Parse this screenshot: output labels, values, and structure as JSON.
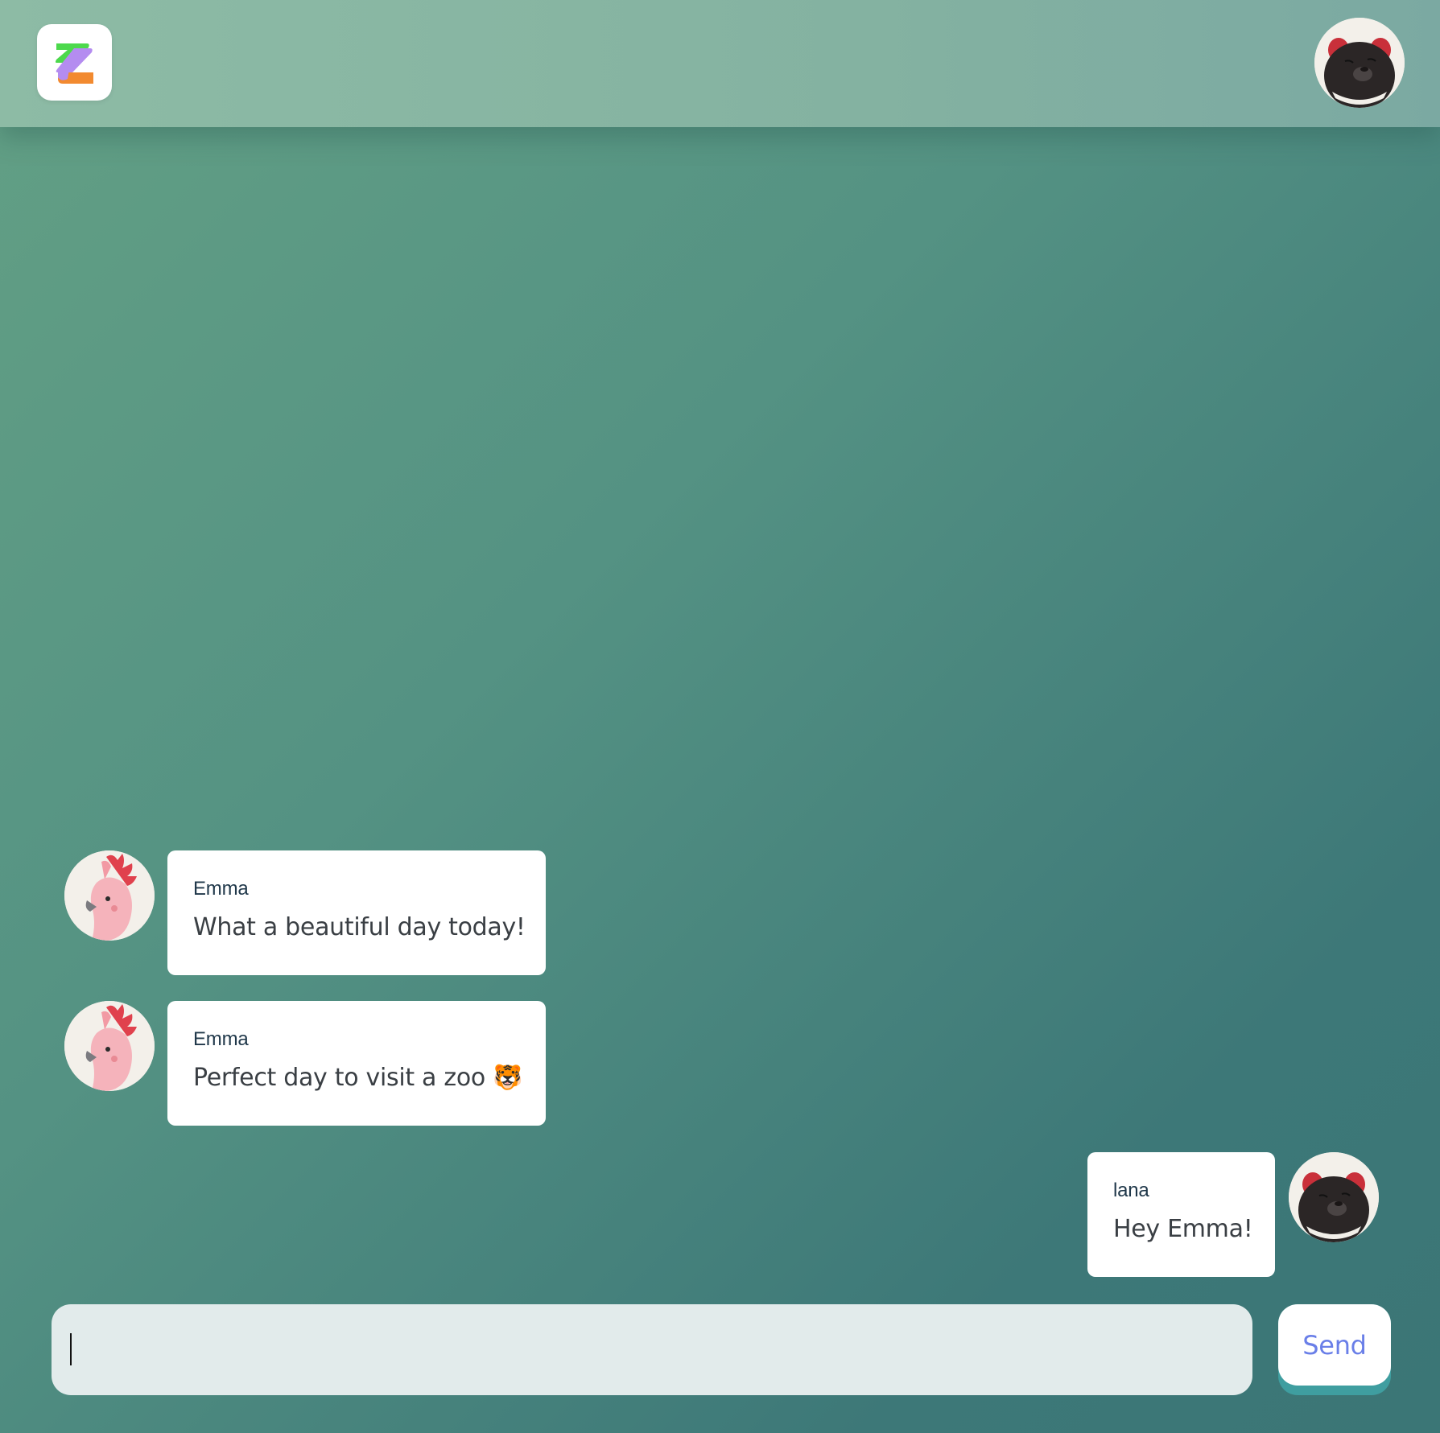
{
  "header": {
    "logo_icon": "zulip-z-logo-icon",
    "current_user_avatar": "tasmanian-devil-avatar-icon"
  },
  "colors": {
    "background_start": "#63a085",
    "background_end": "#3b7676",
    "header": "#88b6a3",
    "bubble": "#ffffff",
    "sender_name": "#20384a",
    "message_text": "#3a3f44",
    "input_background": "#e2ebeb",
    "send_text": "#6a7fe8",
    "send_shadow": "#3f9ea0"
  },
  "messages": [
    {
      "sender": "Emma",
      "text": "What a beautiful day today!",
      "avatar": "cockatoo-avatar-icon",
      "side": "left"
    },
    {
      "sender": "Emma",
      "text": "Perfect day to visit a zoo 🐯",
      "avatar": "cockatoo-avatar-icon",
      "side": "left"
    },
    {
      "sender": "lana",
      "text": "Hey Emma!",
      "avatar": "tasmanian-devil-avatar-icon",
      "side": "right"
    }
  ],
  "composer": {
    "value": "",
    "placeholder": "",
    "send_label": "Send"
  }
}
